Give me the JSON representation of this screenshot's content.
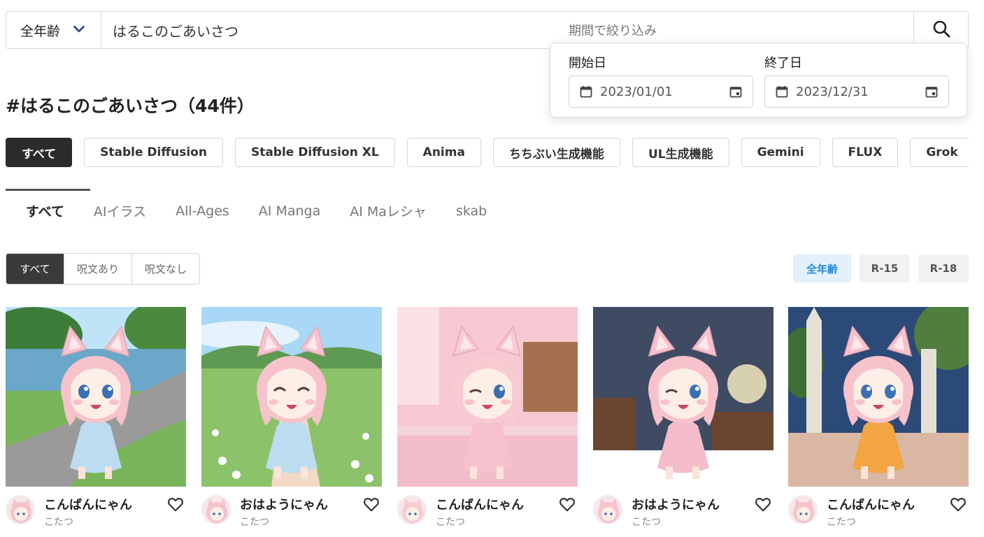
{
  "search": {
    "age_select": "全年齢",
    "query": "はるこのごあいさつ",
    "period_label": "期間で絞り込み"
  },
  "date_filter": {
    "start_label": "開始日",
    "start_value": "2023/01/01",
    "end_label": "終了日",
    "end_value": "2023/12/31"
  },
  "page_title": "#はるこのごあいさつ（44件）",
  "model_chips": [
    {
      "label": "すべて",
      "active": true
    },
    {
      "label": "Stable Diffusion",
      "active": false
    },
    {
      "label": "Stable Diffusion XL",
      "active": false
    },
    {
      "label": "Anima",
      "active": false
    },
    {
      "label": "ちちぶい生成機能",
      "active": false
    },
    {
      "label": "UL生成機能",
      "active": false
    },
    {
      "label": "Gemini",
      "active": false
    },
    {
      "label": "FLUX",
      "active": false
    },
    {
      "label": "Grok",
      "active": false
    }
  ],
  "category_tabs": [
    {
      "label": "すべて",
      "active": true
    },
    {
      "label": "AIイラス",
      "active": false
    },
    {
      "label": "All-Ages",
      "active": false
    },
    {
      "label": "AI Manga",
      "active": false
    },
    {
      "label": "AI Maレシャ",
      "active": false
    },
    {
      "label": "skab",
      "active": false
    }
  ],
  "prompt_filters": [
    {
      "label": "すべて",
      "active": true
    },
    {
      "label": "呪文あり",
      "active": false
    },
    {
      "label": "呪文なし",
      "active": false
    }
  ],
  "age_ratings": [
    {
      "label": "全年齢",
      "active": true
    },
    {
      "label": "R-15",
      "active": false
    },
    {
      "label": "R-18",
      "active": false
    }
  ],
  "cards": [
    {
      "title": "こんばんにゃん",
      "author": "こたつ",
      "scene": "lakeside-path",
      "sky": "#bfe3f7",
      "ground": "#9a9a9a",
      "hair": "#f7c2cc",
      "outfit": "#bcdcf2"
    },
    {
      "title": "おはようにゃん",
      "author": "こたつ",
      "scene": "flower-field-path",
      "sky": "#a8d8f5",
      "ground": "#f1d9c6",
      "hair": "#f7c2cc",
      "outfit": "#bcdcf2"
    },
    {
      "title": "こんばんにゃん",
      "author": "こたつ",
      "scene": "pink-bedroom",
      "sky": "#f6c9d2",
      "ground": "#f3bccb",
      "hair": "#f8cad2",
      "outfit": "#f6c0cc"
    },
    {
      "title": "おはようにゃん",
      "author": "こたつ",
      "scene": "night-bedroom",
      "sky": "#3f4a63",
      "ground": "#ffffff",
      "hair": "#f7c2cc",
      "outfit": "#f4bccb"
    },
    {
      "title": "こんばんにゃん",
      "author": "こたつ",
      "scene": "night-park-monument",
      "sky": "#2b4a78",
      "ground": "#d9b7a3",
      "hair": "#f7c2cc",
      "outfit": "#f3a443"
    }
  ],
  "icons": {
    "age_select_chevron": "chevron-down-icon",
    "search": "search-icon",
    "calendar": "calendar-icon",
    "calendar_picker": "calendar-picker-icon",
    "like": "heart-outline-icon"
  },
  "colors": {
    "active_chip": "#2b2b2b",
    "active_rating_bg": "#e2f1fb",
    "active_rating_text": "#2a8ad4",
    "chevron": "#2a4a8a"
  }
}
